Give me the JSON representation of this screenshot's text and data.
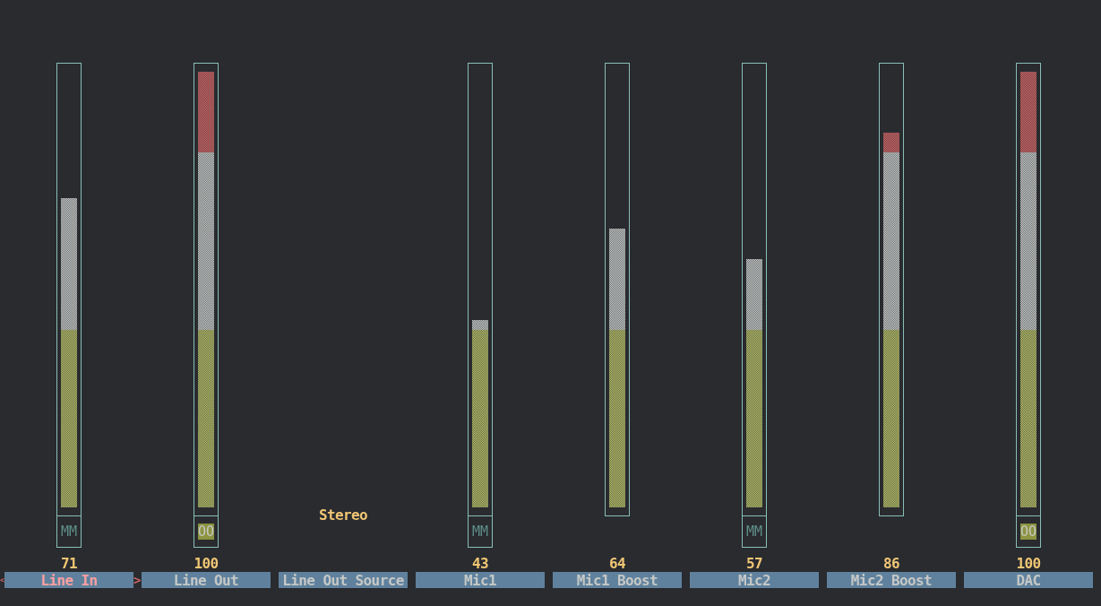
{
  "selection_markers": {
    "left": "<",
    "right": ">"
  },
  "channels": [
    {
      "kind": "volume",
      "name": "Line In",
      "value": "71",
      "level": 0.71,
      "switch": {
        "label": "MM",
        "muted": true
      },
      "selected": true
    },
    {
      "kind": "volume",
      "name": "Line Out",
      "value": "100",
      "level": 1,
      "switch": {
        "label": "OO",
        "muted": false
      },
      "selected": false
    },
    {
      "kind": "enum",
      "name": "Line Out Source",
      "option": "Stereo",
      "selected": false
    },
    {
      "kind": "volume",
      "name": "Mic1",
      "value": "43",
      "level": 0.43,
      "switch": {
        "label": "MM",
        "muted": true
      },
      "selected": false
    },
    {
      "kind": "volume",
      "name": "Mic1 Boost",
      "value": "64",
      "level": 0.64,
      "selected": false
    },
    {
      "kind": "volume",
      "name": "Mic2",
      "value": "57",
      "level": 0.57,
      "switch": {
        "label": "MM",
        "muted": true
      },
      "selected": false
    },
    {
      "kind": "volume",
      "name": "Mic2 Boost",
      "value": "86",
      "level": 0.86,
      "selected": false
    },
    {
      "kind": "volume",
      "name": "DAC",
      "value": "100",
      "level": 1,
      "switch": {
        "label": "OO",
        "muted": false
      },
      "selected": false
    }
  ]
}
